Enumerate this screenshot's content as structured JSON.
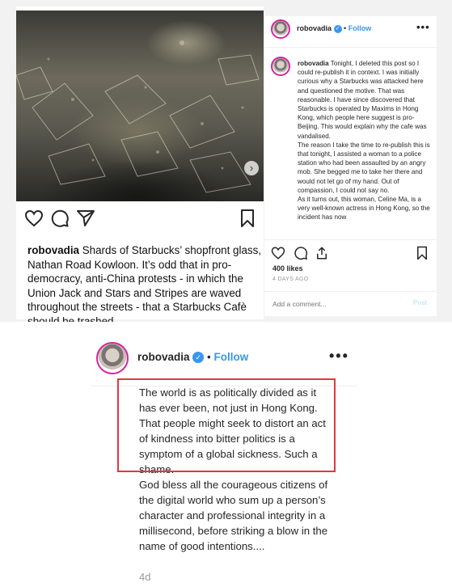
{
  "left_post": {
    "photo_alt": "shattered glass on street",
    "actions": {
      "like": "heart-icon",
      "comment": "comment-icon",
      "share": "paper-plane-icon",
      "save": "bookmark-icon"
    },
    "caption_user": "robovadia",
    "caption_text": "Shards of Starbucks’ shopfront glass, Nathan Road Kowloon. It’s odd that in pro-democracy, anti-China protests - in which the Union Jack and Stars and Stripes are waved throughout the streets - that a Starbucks Cafè should be trashed."
  },
  "right_post": {
    "header": {
      "username": "robovadia",
      "separator": "•",
      "follow": "Follow",
      "more": "•••"
    },
    "comment": {
      "username": "robovadia",
      "text": "Tonight, I deleted this post so I could re-publish it in context. I was initially curious why a Starbucks was attacked here and questioned the motive. That was reasonable. I have since discovered that Starbucks is operated by Maxims in Hong Kong, which people here suggest is pro-Beijing. This would explain why the cafe was vandalised.\nThe reason I take the time to re-publish this is that tonight, I assisted a woman to a police station who had been assaulted by an angry mob. She begged me to take her there and would not let go of my hand. Out of compassion, I could not say no.\nAs it turns out, this woman, Celine Ma, is a very well-known actress in Hong Kong, so the incident has now"
    },
    "likes": "400 likes",
    "time": "4 DAYS AGO",
    "add_comment_placeholder": "Add a comment...",
    "post_button": "Post"
  },
  "bottom_zoom": {
    "username": "robovadia",
    "separator": "•",
    "follow": "Follow",
    "more": "•••",
    "text_highlighted": "The world is as politically divided as it has ever been, not just in Hong Kong. That people might seek to distort an act of kindness into bitter politics is a symptom of a global sickness. Such a shame.",
    "text_rest": "God bless all the courageous citizens of the digital world who sum up a person’s character and professional integrity in a millisecond, before striking a blow in the name of good intentions....",
    "time": "4d",
    "highlight_color": "#e0393e"
  },
  "colors": {
    "link_blue": "#3897f0",
    "text_dark": "#262626",
    "muted_gray": "#999999"
  }
}
